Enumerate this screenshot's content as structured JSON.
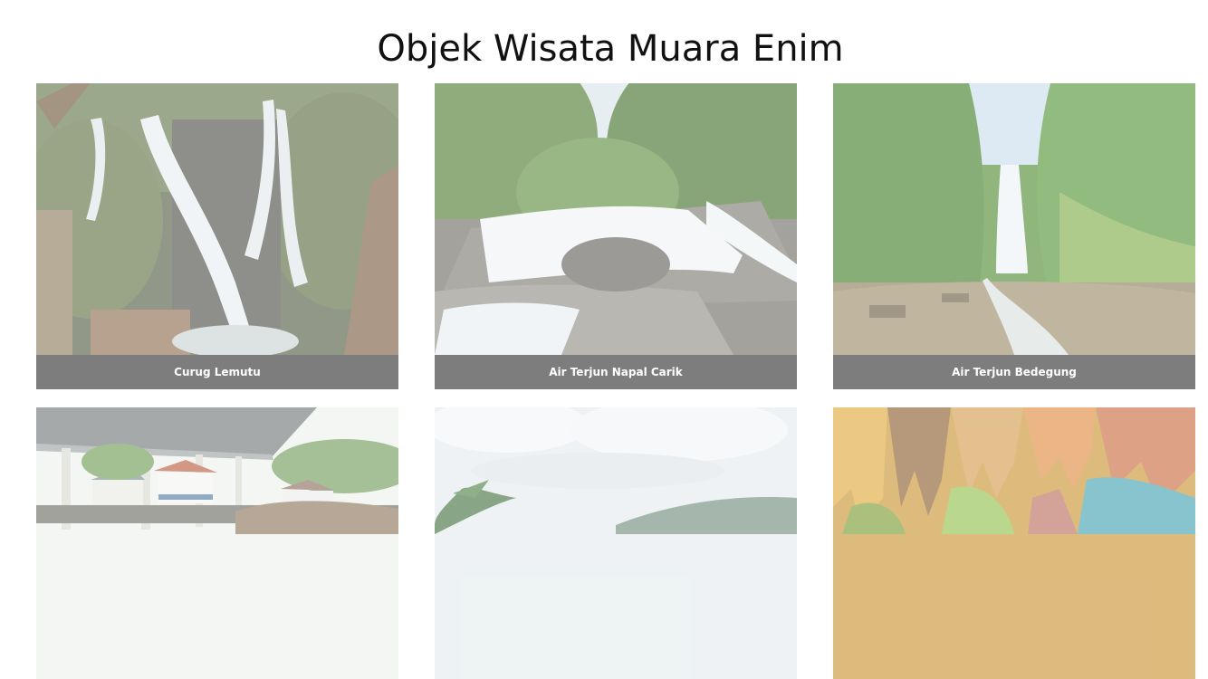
{
  "page": {
    "title": "Objek Wisata Muara Enim"
  },
  "gallery": {
    "items": [
      {
        "caption": "Curug Lemutu",
        "image": "waterfall-rocks-photo"
      },
      {
        "caption": "Air Terjun Napal Carik",
        "image": "river-cascade-photo"
      },
      {
        "caption": "Air Terjun Bedegung",
        "image": "tall-waterfall-photo"
      },
      {
        "caption": "",
        "image": "pavilion-building-photo"
      },
      {
        "caption": "",
        "image": "lake-hills-photo"
      },
      {
        "caption": "",
        "image": "cave-stalactites-photo"
      }
    ]
  },
  "colors": {
    "caption_bg": "#7d7d7d",
    "caption_text": "#ffffff",
    "title_text": "#111111"
  }
}
